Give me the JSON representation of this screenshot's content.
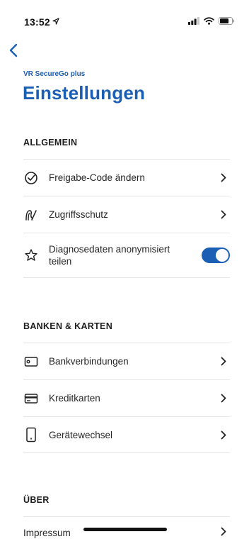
{
  "status": {
    "time": "13:52"
  },
  "header": {
    "app_name": "VR SecureGo plus",
    "title": "Einstellungen"
  },
  "sections": [
    {
      "heading": "ALLGEMEIN",
      "items": [
        {
          "label": "Freigabe-Code ändern",
          "icon": "check-circle-icon",
          "control": "chevron"
        },
        {
          "label": "Zugriffsschutz",
          "icon": "fingerprint-icon",
          "control": "chevron"
        },
        {
          "label": "Diagnosedaten anonymisiert teilen",
          "icon": "star-icon",
          "control": "toggle",
          "toggle_on": true
        }
      ]
    },
    {
      "heading": "BANKEN & KARTEN",
      "items": [
        {
          "label": "Bankverbindungen",
          "icon": "bank-card-icon",
          "control": "chevron"
        },
        {
          "label": "Kreditkarten",
          "icon": "credit-card-icon",
          "control": "chevron"
        },
        {
          "label": "Gerätewechsel",
          "icon": "phone-icon",
          "control": "chevron"
        }
      ]
    },
    {
      "heading": "ÜBER",
      "items": [
        {
          "label": "Impressum",
          "icon": "",
          "control": "chevron"
        }
      ]
    }
  ],
  "colors": {
    "accent": "#1a5fb4",
    "divider": "#e4e4e4"
  }
}
